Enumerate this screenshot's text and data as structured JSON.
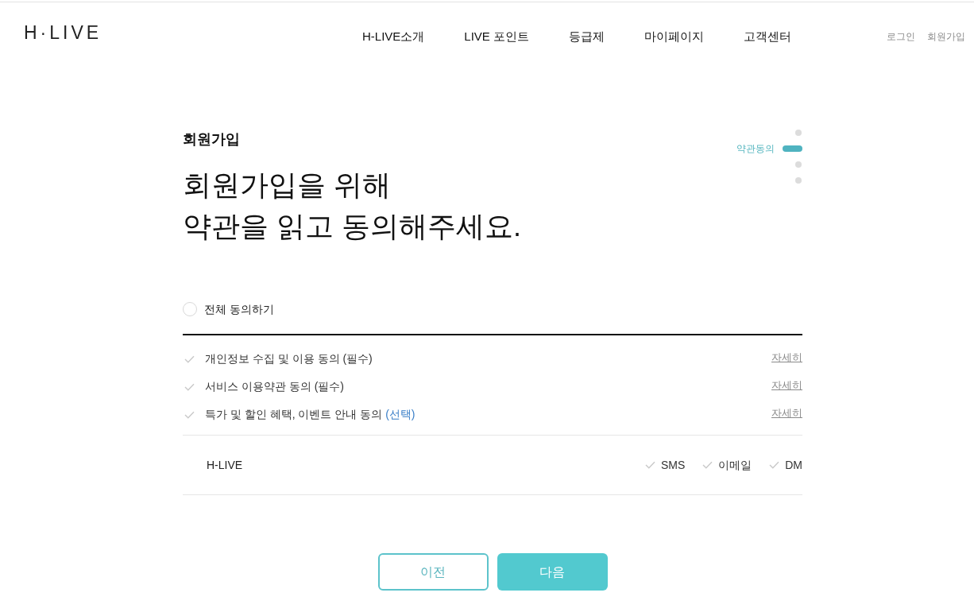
{
  "header": {
    "logo": "H·LIVE",
    "nav": [
      "H-LIVE소개",
      "LIVE 포인트",
      "등급제",
      "마이페이지",
      "고객센터"
    ],
    "account_links": [
      "로그인",
      "회원가입"
    ]
  },
  "steps": [
    {
      "selected": false
    },
    {
      "selected": true,
      "label": "약관동의"
    },
    {
      "selected": false
    },
    {
      "selected": false
    }
  ],
  "intro": {
    "section_title": "회원가입",
    "headline_lines": [
      "회원가입을 위해",
      "약관을 읽고 동의해주세요."
    ]
  },
  "agree_all": {
    "label": "전체 동의하기",
    "checked": false
  },
  "terms": [
    {
      "label": "개인정보 수집 및 이용 동의",
      "tag": "(필수)",
      "kind": "required",
      "checked": false,
      "link": "자세히"
    },
    {
      "label": "서비스 이용약관 동의",
      "tag": "(필수)",
      "kind": "required",
      "checked": false,
      "link": "자세히"
    },
    {
      "label": "특가 및 할인 혜택, 이벤트 안내 동의",
      "tag": "(선택)",
      "kind": "optional",
      "checked": false,
      "link": "자세히"
    }
  ],
  "marketing": {
    "brand": "H-LIVE",
    "channels": [
      {
        "label": "SMS",
        "checked": false
      },
      {
        "label": "이메일",
        "checked": false
      },
      {
        "label": "DM",
        "checked": false
      }
    ]
  },
  "buttons": [
    {
      "label": "이전",
      "kind": "back"
    },
    {
      "label": "다음",
      "kind": "next"
    }
  ]
}
